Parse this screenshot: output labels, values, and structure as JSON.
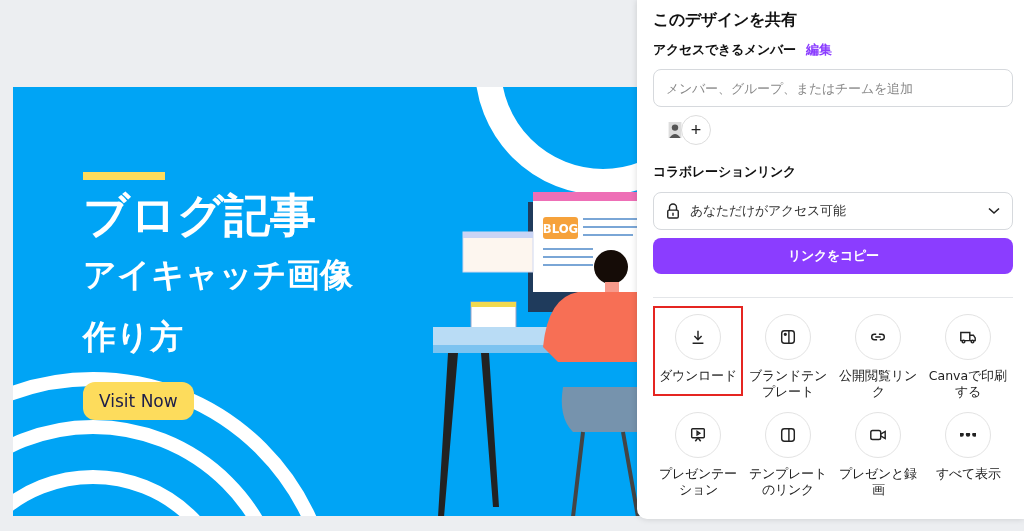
{
  "design": {
    "headline": "ブログ記事",
    "subline_1": "アイキャッチ画像",
    "subline_2": "作り方",
    "button": "Visit Now",
    "blog_badge": "BLOG"
  },
  "share_panel": {
    "title": "このデザインを共有",
    "members_label": "アクセスできるメンバー",
    "edit_link": "編集",
    "member_search": {
      "placeholder": "メンバー、グループ、またはチームを追加"
    },
    "add_member": "+",
    "collab_label": "コラボレーションリンク",
    "access_select": {
      "value": "あなただけがアクセス可能"
    },
    "copy_button": "リンクをコピー",
    "actions": [
      {
        "kind": "download",
        "label": "ダウンロード",
        "highlighted": true
      },
      {
        "kind": "brand-template",
        "label": "ブランドテンプレート",
        "highlighted": false
      },
      {
        "kind": "public-link",
        "label": "公開閲覧リンク",
        "highlighted": false
      },
      {
        "kind": "print",
        "label": "Canvaで印刷する",
        "highlighted": false
      },
      {
        "kind": "presentation",
        "label": "プレゼンテーション",
        "highlighted": false
      },
      {
        "kind": "template-link",
        "label": "テンプレートのリンク",
        "highlighted": false
      },
      {
        "kind": "record",
        "label": "プレゼンと録画",
        "highlighted": false
      },
      {
        "kind": "more",
        "label": "すべて表示",
        "highlighted": false
      }
    ]
  }
}
